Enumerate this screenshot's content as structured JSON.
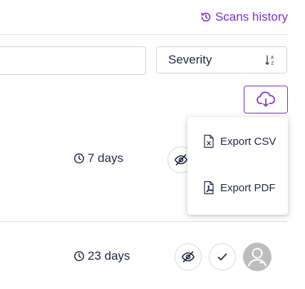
{
  "header": {
    "history_label": "Scans history"
  },
  "filters": {
    "search_value": "",
    "severity_label": "Severity"
  },
  "export_menu": {
    "items": [
      {
        "label": "Export CSV",
        "icon": "file-csv-icon"
      },
      {
        "label": "Export PDF",
        "icon": "file-pdf-icon"
      }
    ]
  },
  "rows": [
    {
      "age": "7 days"
    },
    {
      "age": "23 days"
    }
  ],
  "colors": {
    "accent": "#7b2fd0",
    "text": "#1f2a44",
    "border": "#cfd3da"
  }
}
